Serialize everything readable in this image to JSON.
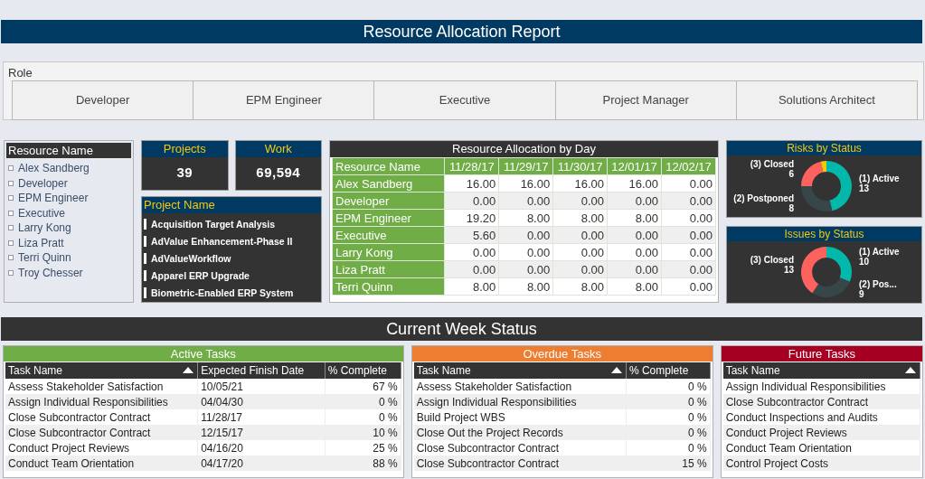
{
  "title": "Resource Allocation Report",
  "role_slicer": {
    "label": "Role",
    "options": [
      {
        "label": "Developer",
        "selected": false
      },
      {
        "label": "EPM Engineer",
        "selected": false
      },
      {
        "label": "Executive",
        "selected": false
      },
      {
        "label": "Project Manager",
        "selected": false
      },
      {
        "label": "Solutions Architect",
        "selected": false
      }
    ]
  },
  "resource_slicer": {
    "header": "Resource Name",
    "items": [
      {
        "label": "Alex Sandberg",
        "checked": false
      },
      {
        "label": "Developer",
        "checked": false
      },
      {
        "label": "EPM Engineer",
        "checked": false
      },
      {
        "label": "Executive",
        "checked": false
      },
      {
        "label": "Larry Kong",
        "checked": false
      },
      {
        "label": "Liza Pratt",
        "checked": false
      },
      {
        "label": "Terri Quinn",
        "checked": false
      },
      {
        "label": "Troy Chesser",
        "checked": false
      }
    ]
  },
  "cards": [
    {
      "title": "Projects",
      "value": "39"
    },
    {
      "title": "Work",
      "value": "69,594"
    }
  ],
  "project_slicer": {
    "header": "Project Name",
    "items": [
      "Acquisition Target Analysis",
      "AdValue Enhancement-Phase II",
      "AdValueWorkflow",
      "Apparel ERP Upgrade",
      "Biometric-Enabled ERP System"
    ]
  },
  "allocation": {
    "title": "Resource Allocation by Day",
    "columns": [
      "Resource Name",
      "11/28/17",
      "11/29/17",
      "11/30/17",
      "12/01/17",
      "12/02/17"
    ],
    "rows": [
      [
        "Alex Sandberg",
        "16.00",
        "16.00",
        "16.00",
        "16.00",
        "0.00"
      ],
      [
        "Developer",
        "0.00",
        "0.00",
        "0.00",
        "0.00",
        "0.00"
      ],
      [
        "EPM Engineer",
        "19.20",
        "8.00",
        "8.00",
        "8.00",
        "0.00"
      ],
      [
        "Executive",
        "5.60",
        "0.00",
        "0.00",
        "0.00",
        "0.00"
      ],
      [
        "Larry Kong",
        "0.00",
        "0.00",
        "0.00",
        "0.00",
        "0.00"
      ],
      [
        "Liza Pratt",
        "0.00",
        "0.00",
        "0.00",
        "0.00",
        "0.00"
      ],
      [
        "Terri Quinn",
        "8.00",
        "8.00",
        "8.00",
        "8.00",
        "0.00"
      ]
    ]
  },
  "status_charts": [
    {
      "title": "Risks by Status",
      "chart_data": {
        "type": "donut",
        "categories": [
          "(1) Active",
          "(2) Postponed",
          "(3) Closed",
          null
        ],
        "series": [
          {
            "values": [
              46.4,
              28.6,
              21.4,
              3.6
            ]
          }
        ],
        "colors": [
          "#01b8aa",
          "#374649",
          "#fd625e",
          "#f2c80f"
        ],
        "value_labels": [
          "13",
          "8",
          "6",
          null
        ]
      }
    },
    {
      "title": "Issues by Status",
      "chart_data": {
        "type": "donut",
        "categories": [
          "(1) Active",
          "(2) Pos...",
          "(3) Closed"
        ],
        "series": [
          {
            "values": [
              31.3,
              28.1,
              40.6
            ]
          }
        ],
        "colors": [
          "#01b8aa",
          "#374649",
          "#fd625e"
        ],
        "value_labels": [
          "10",
          "9",
          "13"
        ]
      }
    }
  ],
  "section_title": "Current Week Status",
  "task_tables": [
    {
      "title": "Active Tasks",
      "color": "#70ad47",
      "columns": [
        {
          "label": "Task Name",
          "sorted": true
        },
        {
          "label": "Expected Finish Date",
          "sorted": false
        },
        {
          "label": "% Complete",
          "sorted": false
        }
      ],
      "rows": [
        [
          "Assess Stakeholder Satisfaction",
          "10/05/21",
          "67 %"
        ],
        [
          "Assign Individual Responsibilities",
          "04/04/30",
          "0 %"
        ],
        [
          "Close Subcontractor Contract",
          "11/28/17",
          "0 %"
        ],
        [
          "Close Subcontractor Contract",
          "12/15/17",
          "10 %"
        ],
        [
          "Conduct Project Reviews",
          "04/16/20",
          "25 %"
        ],
        [
          "Conduct Team Orientation",
          "04/17/20",
          "88 %"
        ]
      ]
    },
    {
      "title": "Overdue Tasks",
      "color": "#ed7d31",
      "columns": [
        {
          "label": "Task Name",
          "sorted": true
        },
        {
          "label": "% Complete",
          "sorted": false
        }
      ],
      "rows": [
        [
          "Assess Stakeholder Satisfaction",
          "0 %"
        ],
        [
          "Assign Individual Responsibilities",
          "0 %"
        ],
        [
          "Build Project WBS",
          "0 %"
        ],
        [
          "Close Out the Project Records",
          "0 %"
        ],
        [
          "Close Subcontractor Contract",
          "0 %"
        ],
        [
          "Close Subcontractor Contract",
          "15 %"
        ]
      ]
    },
    {
      "title": "Future Tasks",
      "color": "#a50021",
      "columns": [
        {
          "label": "Task Name",
          "sorted": true
        }
      ],
      "rows": [
        [
          "Assign Individual Responsibilities"
        ],
        [
          "Close Subcontractor Contract"
        ],
        [
          "Conduct Inspections and Audits"
        ],
        [
          "Conduct Project Reviews"
        ],
        [
          "Conduct Team Orientation"
        ],
        [
          "Control Project Costs"
        ]
      ]
    }
  ]
}
